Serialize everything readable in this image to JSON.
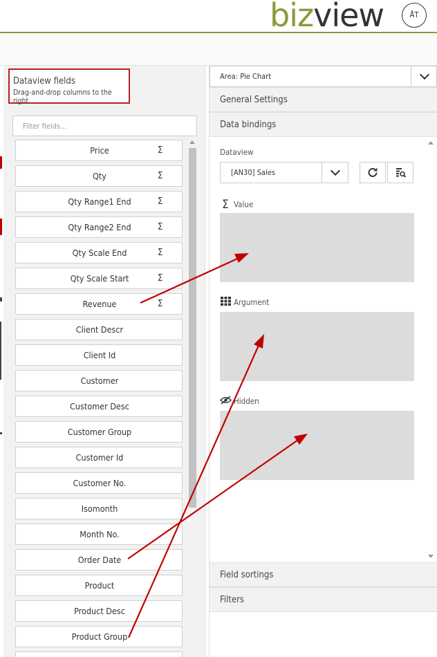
{
  "header": {
    "logo_part1": "biz",
    "logo_part2": "view",
    "user_initials": "ÅT"
  },
  "left_panel": {
    "title": "Dataview fields",
    "subtitle": "Drag-and-drop columns to the right",
    "filter_placeholder": "Filter fields...",
    "sigma_symbol": "Σ",
    "fields": [
      {
        "label": "Price",
        "measure": true
      },
      {
        "label": "Qty",
        "measure": true
      },
      {
        "label": "Qty Range1 End",
        "measure": true
      },
      {
        "label": "Qty Range2 End",
        "measure": true
      },
      {
        "label": "Qty Scale End",
        "measure": true
      },
      {
        "label": "Qty Scale Start",
        "measure": true
      },
      {
        "label": "Revenue",
        "measure": true
      },
      {
        "label": "Client Descr",
        "measure": false
      },
      {
        "label": "Client Id",
        "measure": false
      },
      {
        "label": "Customer",
        "measure": false
      },
      {
        "label": "Customer Desc",
        "measure": false
      },
      {
        "label": "Customer Group",
        "measure": false
      },
      {
        "label": "Customer Id",
        "measure": false
      },
      {
        "label": "Customer No.",
        "measure": false
      },
      {
        "label": "Isomonth",
        "measure": false
      },
      {
        "label": "Month No.",
        "measure": false
      },
      {
        "label": "Order Date",
        "measure": false
      },
      {
        "label": "Product",
        "measure": false
      },
      {
        "label": "Product Desc",
        "measure": false
      },
      {
        "label": "Product Group",
        "measure": false
      },
      {
        "label": "",
        "measure": false
      }
    ]
  },
  "right_panel": {
    "area_select": "Area: Pie Chart",
    "sections": {
      "general": "General Settings",
      "bindings": "Data bindings",
      "sortings": "Field sortings",
      "filters": "Filters"
    },
    "dataview_label": "Dataview",
    "dataview_value": "[AN30] Sales",
    "drop_zones": [
      {
        "label": "Value",
        "icon": "sigma-icon"
      },
      {
        "label": "Argument",
        "icon": "grid-icon"
      },
      {
        "label": "Hidden",
        "icon": "eye-slash-icon"
      }
    ]
  },
  "annotation_color": "#c00000",
  "accent_color": "#8a9a3c"
}
